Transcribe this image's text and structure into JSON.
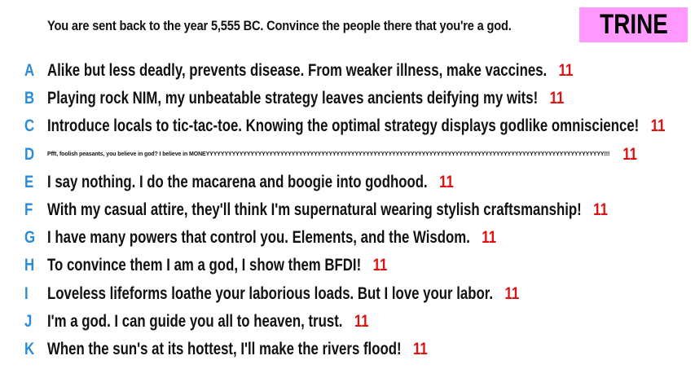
{
  "header": {
    "prompt": "You are sent back to the year 5,555 BC. Convince the people there that you're a god.",
    "badge": "TRINE"
  },
  "colors": {
    "letter": "#2a8bd8",
    "score": "#e01010",
    "badge_bg": "#ff99ff"
  },
  "answers": [
    {
      "letter": "A",
      "text": "Alike but less deadly, prevents disease. From weaker illness, make vaccines.",
      "score": "11"
    },
    {
      "letter": "B",
      "text": "Playing rock NIM, my unbeatable strategy leaves ancients deifying my wits!",
      "score": "11"
    },
    {
      "letter": "C",
      "text": "Introduce locals to tic-tac-toe. Knowing the optimal strategy displays godlike omniscience!",
      "score": "11"
    },
    {
      "letter": "D",
      "text": "Pfft, foolish peasants, you believe in god? I believe in MONEYYYYYYYYYYYYYYYYYYYYYYYYYYYYYYYYYYYYYYYYYYYYYYYYYYYYYYYYYYYYYYYYYYYYYYYYYYYYYYYYYYYYYYYYYYYYYYYYYYYYYYYYYYY!!!",
      "score": "11"
    },
    {
      "letter": "E",
      "text": "I say nothing. I do the macarena and boogie into godhood.",
      "score": "11"
    },
    {
      "letter": "F",
      "text": "With my casual attire, they'll think I'm supernatural wearing stylish craftsmanship!",
      "score": "11"
    },
    {
      "letter": "G",
      "text": "I have many powers that control you. Elements, and the Wisdom.",
      "score": "11"
    },
    {
      "letter": "H",
      "text": "To convince them I am a god, I show them BFDI!",
      "score": "11"
    },
    {
      "letter": "I",
      "text": "Loveless lifeforms loathe your laborious loads. But I love your labor.",
      "score": "11"
    },
    {
      "letter": "J",
      "text": "I'm a god. I can guide you all to heaven, trust.",
      "score": "11"
    },
    {
      "letter": "K",
      "text": "When the sun's at its hottest, I'll make the rivers flood!",
      "score": "11"
    }
  ]
}
